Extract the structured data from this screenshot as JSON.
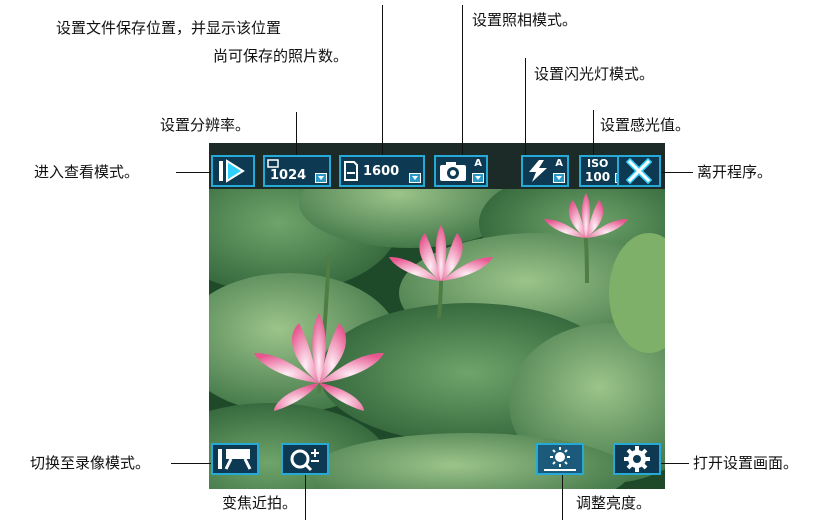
{
  "labels": {
    "view_mode": "进入查看模式。",
    "resolution": "设置分辨率。",
    "save_location_1": "设置文件保存位置，并显示该位置",
    "save_location_2": "尚可保存的照片数。",
    "camera_mode": "设置照相模式。",
    "flash_mode": "设置闪光灯模式。",
    "iso": "设置感光值。",
    "exit": "离开程序。",
    "video_mode": "切换至录像模式。",
    "zoom_macro": "变焦近拍。",
    "brightness": "调整亮度。",
    "settings": "打开设置画面。"
  },
  "toolbar": {
    "resolution_value": "1024",
    "save_count_value": "1600",
    "camera_badge": "A",
    "flash_badge": "A",
    "iso_label": "ISO",
    "iso_value": "100"
  },
  "colors": {
    "button_border": "#27a9d6",
    "button_fill": "#0d3a52",
    "topbar": "#1d2b28"
  },
  "icons": [
    "play-icon",
    "resolution-icon",
    "memory-card-icon",
    "camera-icon",
    "flash-icon",
    "iso-icon",
    "close-icon",
    "video-camera-icon",
    "zoom-macro-icon",
    "brightness-icon",
    "gear-icon"
  ]
}
